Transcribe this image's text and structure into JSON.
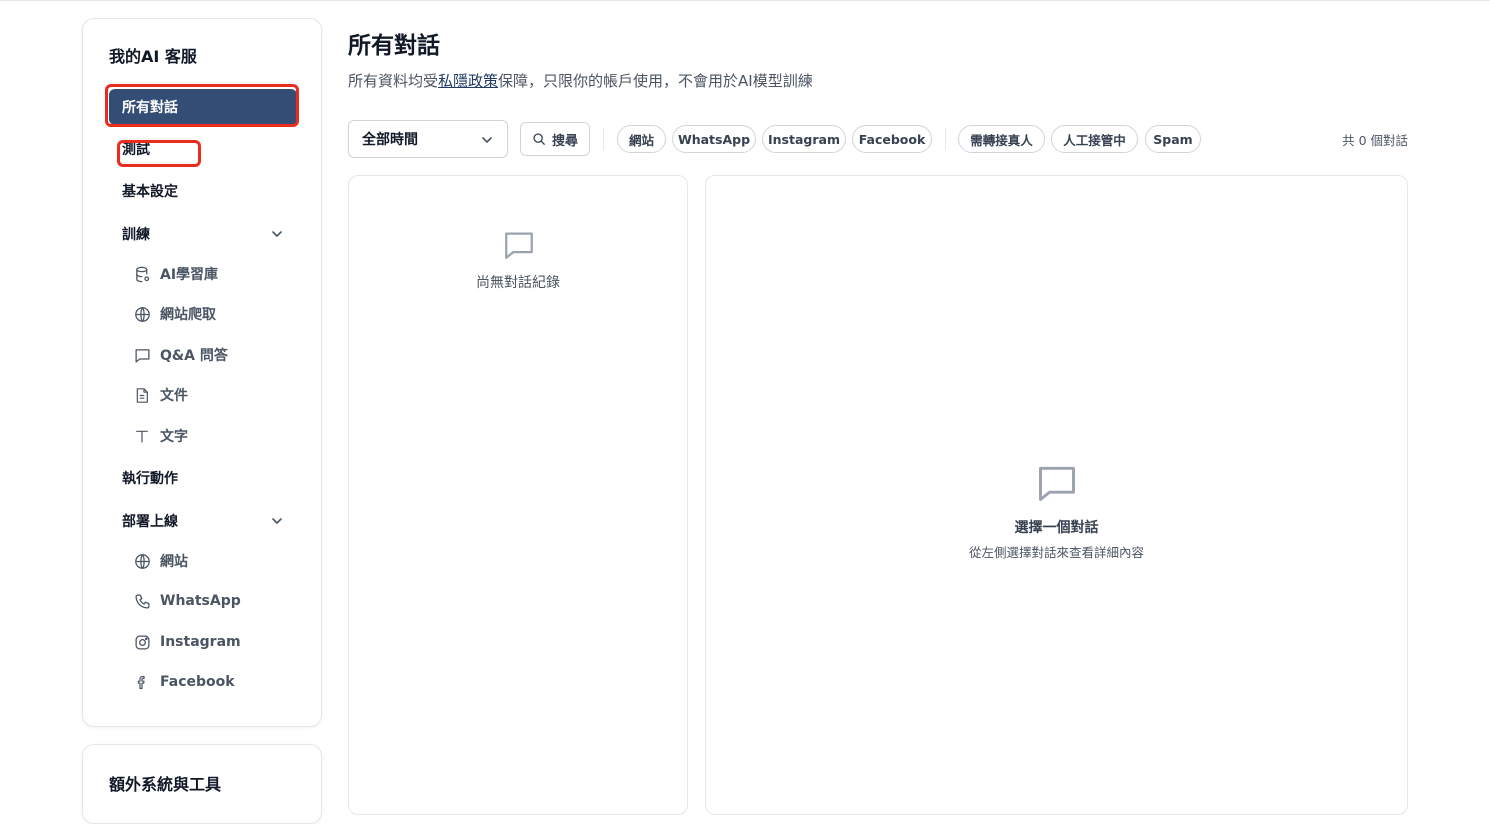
{
  "sidebar": {
    "title": "我的AI 客服",
    "items": [
      {
        "label": "所有對話",
        "active": true
      },
      {
        "label": "測試"
      },
      {
        "label": "基本設定"
      },
      {
        "label": "訓練",
        "expandable": true
      },
      {
        "label": "執行動作"
      },
      {
        "label": "部署上線",
        "expandable": true
      }
    ],
    "training_subitems": [
      {
        "label": "AI學習庫",
        "icon": "database-icon"
      },
      {
        "label": "網站爬取",
        "icon": "globe-icon"
      },
      {
        "label": "Q&A 問答",
        "icon": "message-square-icon"
      },
      {
        "label": "文件",
        "icon": "file-text-icon"
      },
      {
        "label": "文字",
        "icon": "text-t-icon"
      }
    ],
    "deploy_subitems": [
      {
        "label": "網站",
        "icon": "globe-icon"
      },
      {
        "label": "WhatsApp",
        "icon": "phone-icon"
      },
      {
        "label": "Instagram",
        "icon": "instagram-icon"
      },
      {
        "label": "Facebook",
        "icon": "facebook-icon"
      }
    ],
    "extra_title": "額外系統與工具"
  },
  "header": {
    "title": "所有對話",
    "subtitle_prefix": "所有資料均受",
    "subtitle_link": "私隱政策",
    "subtitle_suffix": "保障，只限你的帳戶使用，不會用於AI模型訓練"
  },
  "filters": {
    "time_select": "全部時間",
    "search_label": "搜尋",
    "channel_chips": [
      "網站",
      "WhatsApp",
      "Instagram",
      "Facebook"
    ],
    "status_chips": [
      "需轉接真人",
      "人工接管中",
      "Spam"
    ],
    "count_text": "共 0 個對話"
  },
  "conversation_list": {
    "empty_text": "尚無對話紀錄"
  },
  "detail": {
    "empty_title": "選擇一個對話",
    "empty_desc": "從左側選擇對話來查看詳細內容"
  },
  "colors": {
    "active_nav_bg": "#334d75",
    "annotation_red": "#ec2b1f",
    "link": "#1f3b66"
  }
}
